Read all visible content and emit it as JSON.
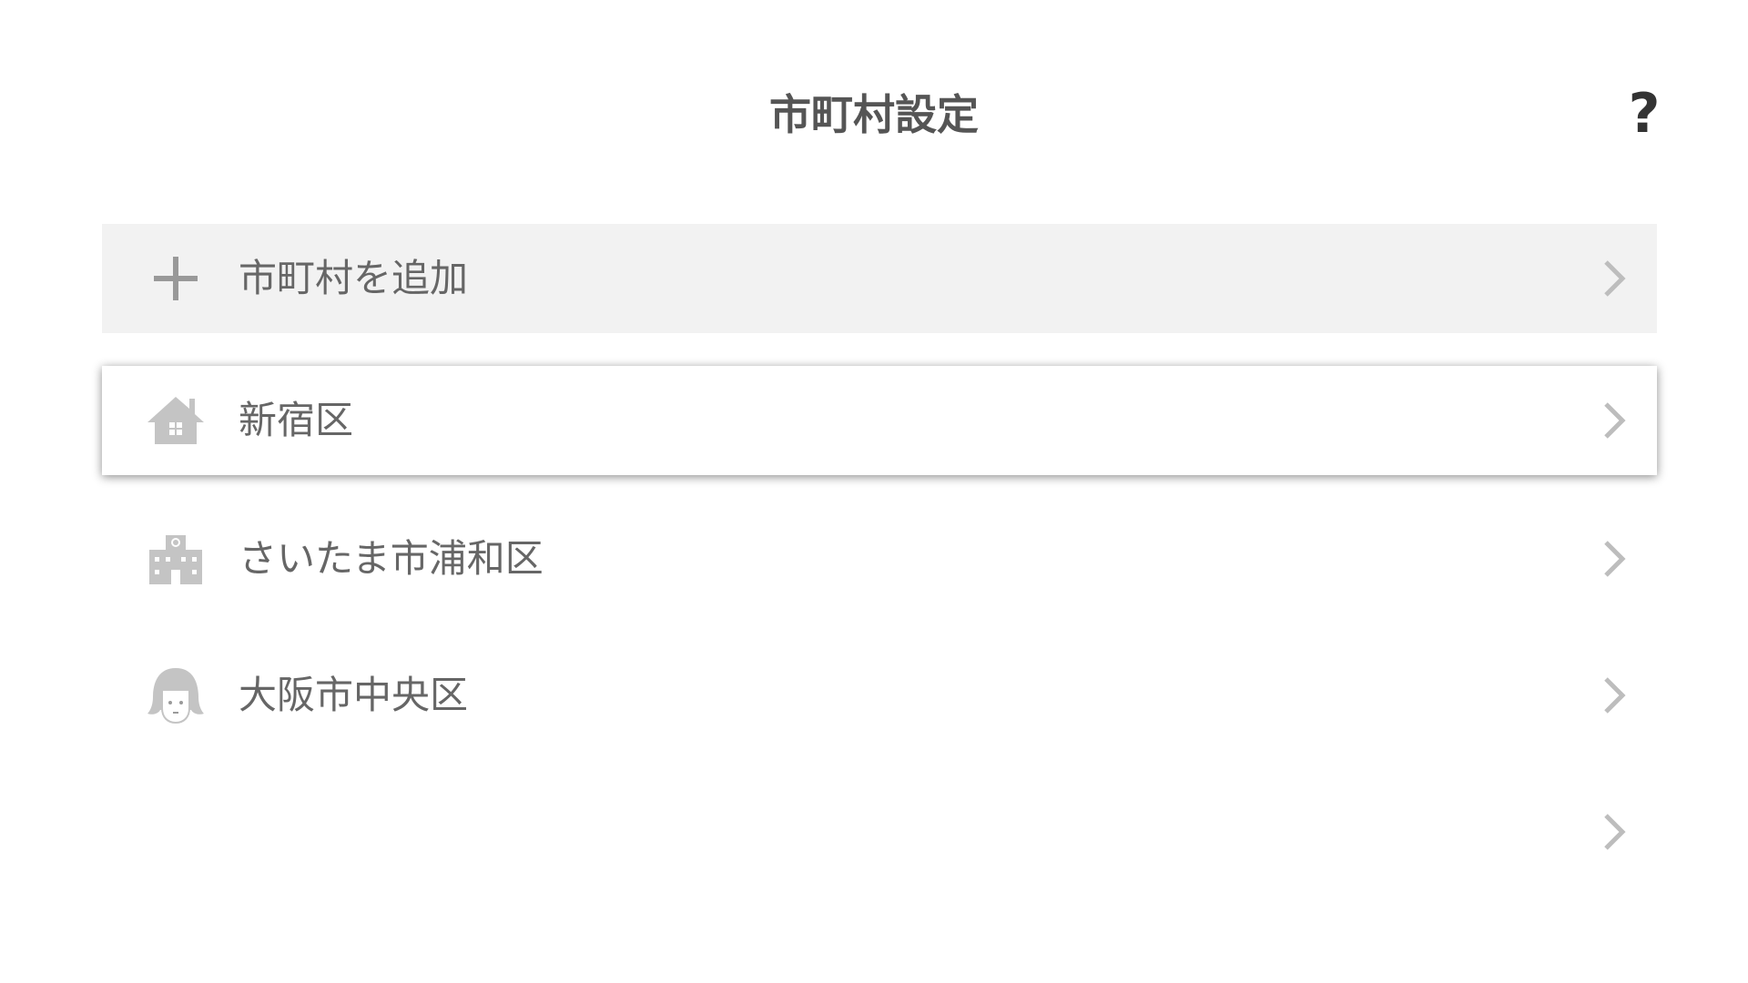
{
  "header": {
    "title": "市町村設定",
    "help_label": "?"
  },
  "rows": [
    {
      "label": "市町村を追加",
      "icon": "plus-icon"
    },
    {
      "label": "新宿区",
      "icon": "house-icon",
      "selected": true
    },
    {
      "label": "さいたま市浦和区",
      "icon": "building-icon"
    },
    {
      "label": "大阪市中央区",
      "icon": "girl-face-icon"
    },
    {
      "label": "",
      "icon": ""
    }
  ],
  "colors": {
    "title": "#555555",
    "label": "#666666",
    "icon": "#c4c4c4",
    "add_row_bg": "#f2f2f2",
    "help": "#333333"
  }
}
